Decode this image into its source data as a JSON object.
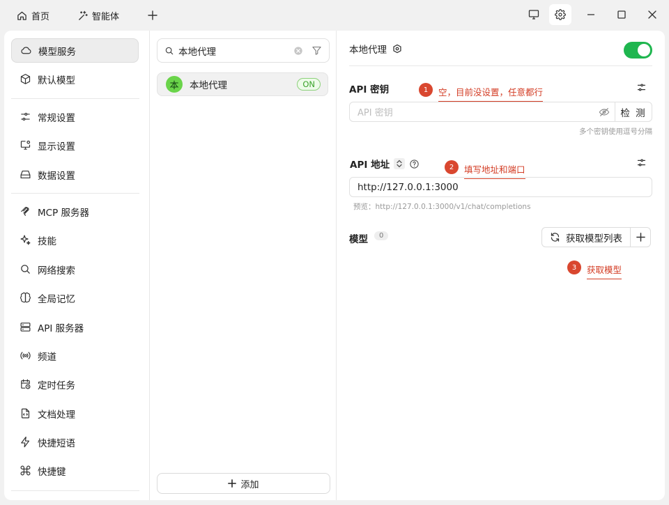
{
  "titlebar": {
    "tabs": [
      {
        "label": "首页",
        "icon": "home-icon"
      },
      {
        "label": "智能体",
        "icon": "magic-wand-icon"
      }
    ]
  },
  "sidebar": {
    "items": [
      {
        "label": "模型服务",
        "icon": "cloud-icon",
        "active": true
      },
      {
        "label": "默认模型",
        "icon": "cube-icon"
      },
      {
        "label": "常规设置",
        "icon": "sliders-icon"
      },
      {
        "label": "显示设置",
        "icon": "monitor-settings-icon"
      },
      {
        "label": "数据设置",
        "icon": "hard-drive-icon"
      },
      {
        "label": "MCP 服务器",
        "icon": "mcp-icon"
      },
      {
        "label": "技能",
        "icon": "sparkles-icon"
      },
      {
        "label": "网络搜索",
        "icon": "search-icon"
      },
      {
        "label": "全局记忆",
        "icon": "brain-icon"
      },
      {
        "label": "API 服务器",
        "icon": "server-icon"
      },
      {
        "label": "频道",
        "icon": "broadcast-icon"
      },
      {
        "label": "定时任务",
        "icon": "calendar-clock-icon"
      },
      {
        "label": "文档处理",
        "icon": "file-code-icon"
      },
      {
        "label": "快捷短语",
        "icon": "zap-icon"
      },
      {
        "label": "快捷键",
        "icon": "command-icon"
      }
    ]
  },
  "providers": {
    "search_value": "本地代理",
    "items": [
      {
        "avatar": "本",
        "name": "本地代理",
        "status": "ON"
      }
    ],
    "add_label": "添加"
  },
  "detail": {
    "title": "本地代理",
    "enabled": true,
    "api_key": {
      "title": "API 密钥",
      "placeholder": "API 密钥",
      "check_label": "检 测",
      "hint": "多个密钥使用逗号分隔"
    },
    "api_url": {
      "title": "API 地址",
      "value": "http://127.0.0.1:3000",
      "preview": "预览：http://127.0.0.1:3000/v1/chat/completions"
    },
    "models": {
      "title": "模型",
      "count": "0",
      "fetch_label": "获取模型列表"
    }
  },
  "annotations": [
    {
      "num": "1",
      "text": "空，目前没设置，任意都行"
    },
    {
      "num": "2",
      "text": "填写地址和端口"
    },
    {
      "num": "3",
      "text": "获取模型"
    }
  ],
  "colors": {
    "accent_green": "#1fb64f",
    "annotation_red": "#d9472f",
    "avatar_green": "#6ad44a"
  }
}
